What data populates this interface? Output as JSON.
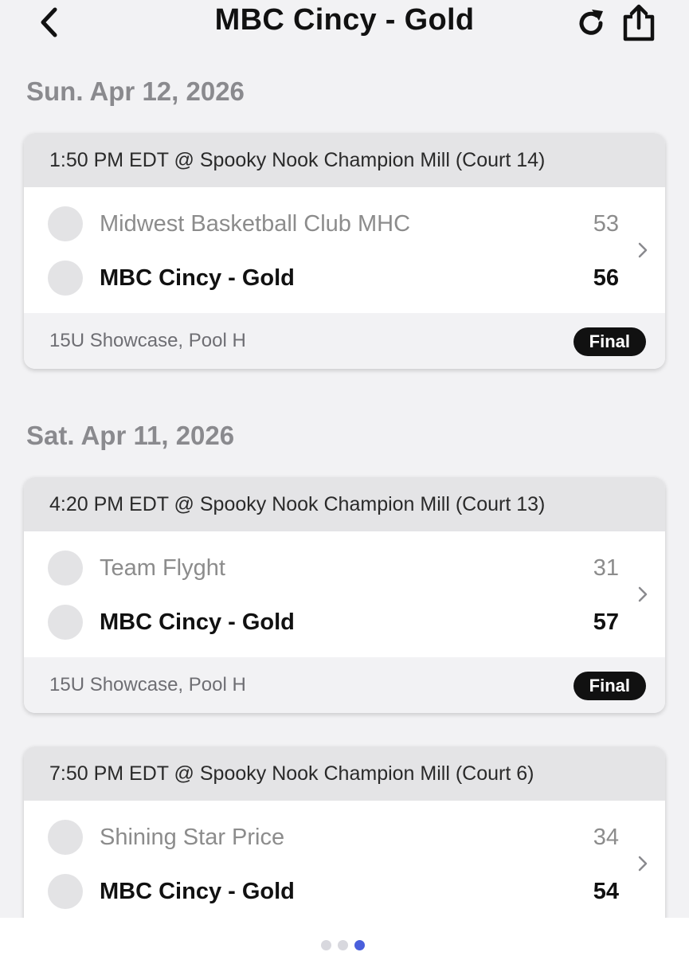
{
  "header": {
    "title": "MBC Cincy - Gold"
  },
  "days": [
    {
      "date": "Sun. Apr 12, 2026",
      "games": [
        {
          "time_location": "1:50 PM EDT @ Spooky Nook Champion Mill (Court 14)",
          "team1": {
            "name": "Midwest Basketball Club MHC",
            "score": "53"
          },
          "team2": {
            "name": "MBC Cincy - Gold",
            "score": "56"
          },
          "division": "15U Showcase, Pool H",
          "status": "Final"
        }
      ]
    },
    {
      "date": "Sat. Apr 11, 2026",
      "games": [
        {
          "time_location": "4:20 PM EDT @ Spooky Nook Champion Mill (Court 13)",
          "team1": {
            "name": "Team Flyght",
            "score": "31"
          },
          "team2": {
            "name": "MBC Cincy - Gold",
            "score": "57"
          },
          "division": "15U Showcase, Pool H",
          "status": "Final"
        },
        {
          "time_location": "7:50 PM EDT @ Spooky Nook Champion Mill (Court 6)",
          "team1": {
            "name": "Shining Star Price",
            "score": "34"
          },
          "team2": {
            "name": "MBC Cincy - Gold",
            "score": "54"
          }
        }
      ]
    }
  ],
  "icons": {
    "back": "chevron-left-icon",
    "refresh": "refresh-icon",
    "share": "share-icon",
    "row_chevron": "chevron-right-icon"
  },
  "pager": {
    "count": 3,
    "active_index": 2
  },
  "colors": {
    "background": "#f2f2f4",
    "card_header": "#e4e4e6",
    "badge": "#111111",
    "pager_active": "#4a5fdc"
  }
}
